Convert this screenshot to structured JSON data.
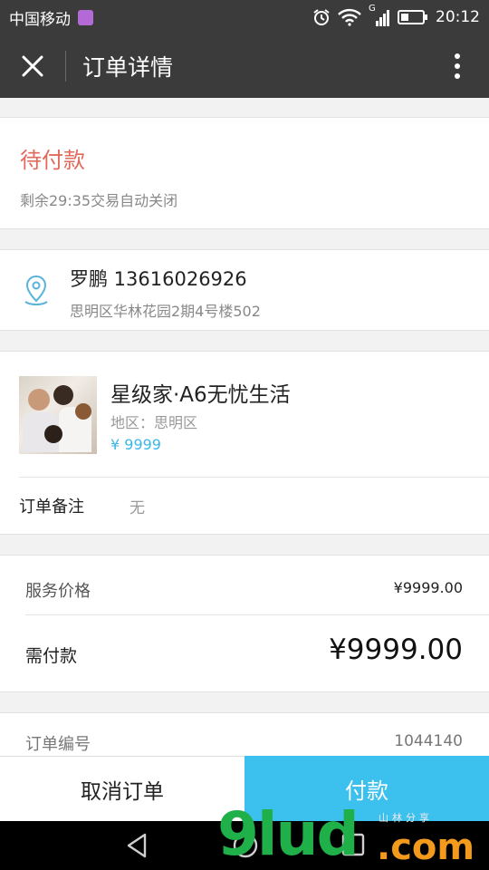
{
  "status_bar": {
    "carrier": "中国移动",
    "net_type": "G",
    "time": "20:12"
  },
  "header": {
    "title": "订单详情"
  },
  "order_status": {
    "state": "待付款",
    "countdown": "剩余29:35交易自动关闭"
  },
  "address": {
    "name_phone": "罗鹏 13616026926",
    "detail": "思明区华林花园2期4号楼502"
  },
  "product": {
    "title": "星级家·A6无忧生活",
    "region": "地区：思明区",
    "price": "¥ 9999"
  },
  "note": {
    "label": "订单备注",
    "value": "无"
  },
  "pricing": {
    "service_label": "服务价格",
    "service_value": "¥9999.00",
    "payable_label": "需付款",
    "payable_value": "¥9999.00"
  },
  "order": {
    "number_label": "订单编号",
    "number_value": "1044140"
  },
  "actions": {
    "cancel": "取消订单",
    "pay": "付款"
  },
  "watermark": {
    "brand": "9lud",
    "suffix": ".com",
    "small": "山林分享"
  },
  "colors": {
    "accent": "#3cc1ef",
    "pending": "#e06a5c",
    "price": "#3bb7e8"
  }
}
